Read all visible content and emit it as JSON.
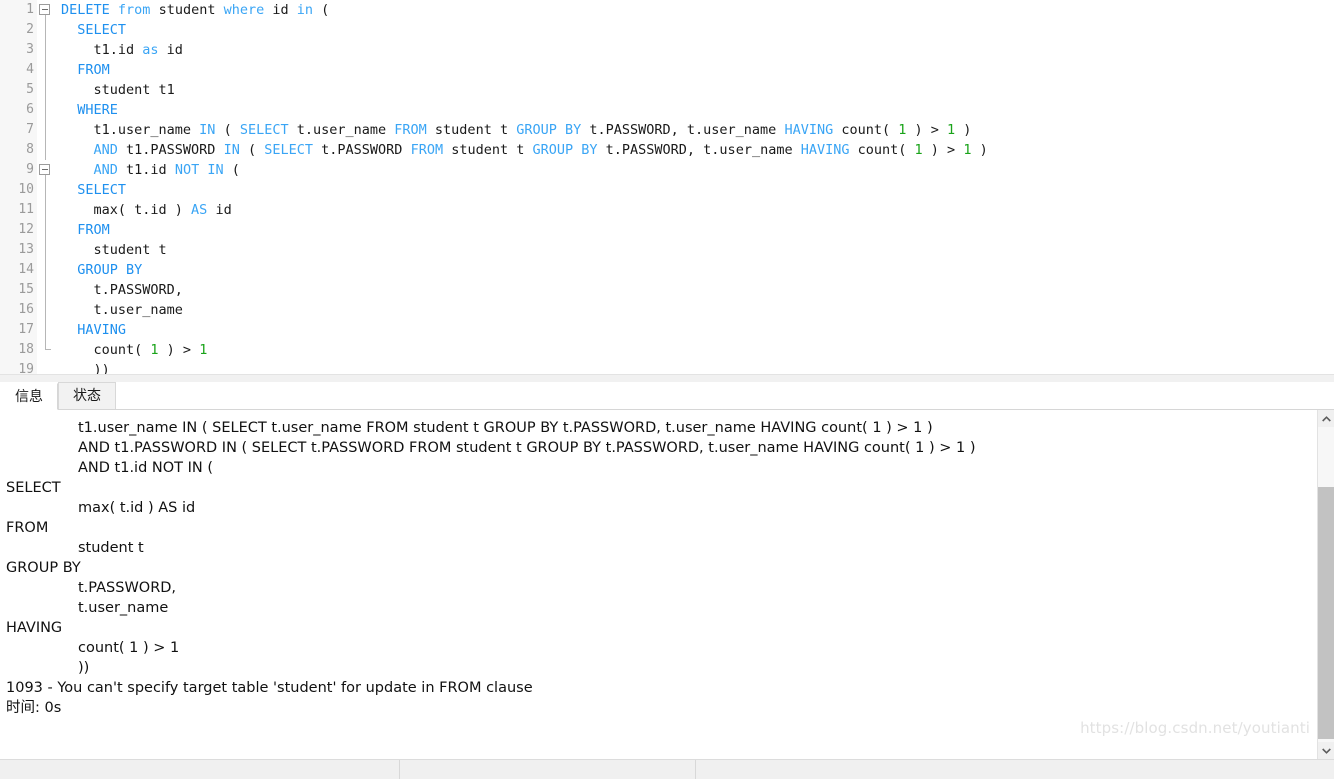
{
  "editor": {
    "language": "sql",
    "lines": [
      {
        "n": "1",
        "fold": "start",
        "tokens": [
          {
            "t": "DELETE",
            "c": "kw"
          },
          {
            "t": " ",
            "c": "pl"
          },
          {
            "t": "from",
            "c": "kw2"
          },
          {
            "t": " student ",
            "c": "pl"
          },
          {
            "t": "where",
            "c": "kw2"
          },
          {
            "t": " id ",
            "c": "pl"
          },
          {
            "t": "in",
            "c": "kw2"
          },
          {
            "t": " (",
            "c": "pl"
          }
        ]
      },
      {
        "n": "2",
        "fold": "guide",
        "tokens": [
          {
            "t": "  ",
            "c": "pl"
          },
          {
            "t": "SELECT",
            "c": "kw"
          }
        ]
      },
      {
        "n": "3",
        "fold": "guide",
        "tokens": [
          {
            "t": "    t1.id ",
            "c": "pl"
          },
          {
            "t": "as",
            "c": "kw2"
          },
          {
            "t": " id",
            "c": "pl"
          }
        ]
      },
      {
        "n": "4",
        "fold": "guide",
        "tokens": [
          {
            "t": "  ",
            "c": "pl"
          },
          {
            "t": "FROM",
            "c": "kw"
          }
        ]
      },
      {
        "n": "5",
        "fold": "guide",
        "tokens": [
          {
            "t": "    student t1",
            "c": "pl"
          }
        ]
      },
      {
        "n": "6",
        "fold": "guide",
        "tokens": [
          {
            "t": "  ",
            "c": "pl"
          },
          {
            "t": "WHERE",
            "c": "kw"
          }
        ]
      },
      {
        "n": "7",
        "fold": "guide",
        "tokens": [
          {
            "t": "    t1.user_name ",
            "c": "pl"
          },
          {
            "t": "IN",
            "c": "kw2"
          },
          {
            "t": " ( ",
            "c": "pl"
          },
          {
            "t": "SELECT",
            "c": "kw2"
          },
          {
            "t": " t.user_name ",
            "c": "pl"
          },
          {
            "t": "FROM",
            "c": "kw2"
          },
          {
            "t": " student t ",
            "c": "pl"
          },
          {
            "t": "GROUP BY",
            "c": "kw2"
          },
          {
            "t": " t.PASSWORD",
            "c": "pl"
          },
          {
            "t": ", t.user_name ",
            "c": "pl"
          },
          {
            "t": "HAVING",
            "c": "kw2"
          },
          {
            "t": " count( ",
            "c": "pl"
          },
          {
            "t": "1",
            "c": "num"
          },
          {
            "t": " ) > ",
            "c": "pl"
          },
          {
            "t": "1",
            "c": "num"
          },
          {
            "t": " )",
            "c": "pl"
          }
        ]
      },
      {
        "n": "8",
        "fold": "guide",
        "tokens": [
          {
            "t": "    ",
            "c": "pl"
          },
          {
            "t": "AND",
            "c": "kw2"
          },
          {
            "t": " t1.PASSWORD ",
            "c": "pl"
          },
          {
            "t": "IN",
            "c": "kw2"
          },
          {
            "t": " ( ",
            "c": "pl"
          },
          {
            "t": "SELECT",
            "c": "kw2"
          },
          {
            "t": " t.PASSWORD ",
            "c": "pl"
          },
          {
            "t": "FROM",
            "c": "kw2"
          },
          {
            "t": " student t ",
            "c": "pl"
          },
          {
            "t": "GROUP BY",
            "c": "kw2"
          },
          {
            "t": " t.PASSWORD",
            "c": "pl"
          },
          {
            "t": ", t.user_name ",
            "c": "pl"
          },
          {
            "t": "HAVING",
            "c": "kw2"
          },
          {
            "t": " count( ",
            "c": "pl"
          },
          {
            "t": "1",
            "c": "num"
          },
          {
            "t": " ) > ",
            "c": "pl"
          },
          {
            "t": "1",
            "c": "num"
          },
          {
            "t": " )",
            "c": "pl"
          }
        ]
      },
      {
        "n": "9",
        "fold": "start2",
        "tokens": [
          {
            "t": "    ",
            "c": "pl"
          },
          {
            "t": "AND",
            "c": "kw2"
          },
          {
            "t": " t1.id ",
            "c": "pl"
          },
          {
            "t": "NOT IN",
            "c": "kw2"
          },
          {
            "t": " (",
            "c": "pl"
          }
        ]
      },
      {
        "n": "10",
        "fold": "guide",
        "tokens": [
          {
            "t": "  ",
            "c": "pl"
          },
          {
            "t": "SELECT",
            "c": "kw"
          }
        ]
      },
      {
        "n": "11",
        "fold": "guide",
        "tokens": [
          {
            "t": "    max( t.id ) ",
            "c": "pl"
          },
          {
            "t": "AS",
            "c": "kw2"
          },
          {
            "t": " id",
            "c": "pl"
          }
        ]
      },
      {
        "n": "12",
        "fold": "guide",
        "tokens": [
          {
            "t": "  ",
            "c": "pl"
          },
          {
            "t": "FROM",
            "c": "kw"
          }
        ]
      },
      {
        "n": "13",
        "fold": "guide",
        "tokens": [
          {
            "t": "    student t",
            "c": "pl"
          }
        ]
      },
      {
        "n": "14",
        "fold": "guide",
        "tokens": [
          {
            "t": "  ",
            "c": "pl"
          },
          {
            "t": "GROUP BY",
            "c": "kw"
          }
        ]
      },
      {
        "n": "15",
        "fold": "guide",
        "tokens": [
          {
            "t": "    t.PASSWORD,",
            "c": "pl"
          }
        ]
      },
      {
        "n": "16",
        "fold": "guide",
        "tokens": [
          {
            "t": "    t.user_name",
            "c": "pl"
          }
        ]
      },
      {
        "n": "17",
        "fold": "guide",
        "tokens": [
          {
            "t": "  ",
            "c": "pl"
          },
          {
            "t": "HAVING",
            "c": "kw"
          }
        ]
      },
      {
        "n": "18",
        "fold": "end",
        "tokens": [
          {
            "t": "    count( ",
            "c": "pl"
          },
          {
            "t": "1",
            "c": "num"
          },
          {
            "t": " ) > ",
            "c": "pl"
          },
          {
            "t": "1",
            "c": "num"
          }
        ]
      },
      {
        "n": "19",
        "fold": "none",
        "tokens": [
          {
            "t": "    ))",
            "c": "pl"
          }
        ]
      }
    ]
  },
  "tabs": [
    {
      "label": "信息",
      "active": true
    },
    {
      "label": "状态",
      "active": false
    }
  ],
  "result": {
    "lines": [
      {
        "text": "t1.user_name IN ( SELECT t.user_name FROM student t GROUP BY t.PASSWORD, t.user_name HAVING count( 1 ) > 1 )",
        "indent": true
      },
      {
        "text": "AND t1.PASSWORD IN ( SELECT t.PASSWORD FROM student t GROUP BY t.PASSWORD, t.user_name HAVING count( 1 ) > 1 )",
        "indent": true
      },
      {
        "text": "AND t1.id NOT IN (",
        "indent": true
      },
      {
        "text": "SELECT",
        "indent": false
      },
      {
        "text": "max( t.id ) AS id",
        "indent": true
      },
      {
        "text": "FROM",
        "indent": false
      },
      {
        "text": "student t",
        "indent": true
      },
      {
        "text": "GROUP BY",
        "indent": false
      },
      {
        "text": "t.PASSWORD,",
        "indent": true
      },
      {
        "text": "t.user_name",
        "indent": true
      },
      {
        "text": "HAVING",
        "indent": false
      },
      {
        "text": "count( 1 ) > 1",
        "indent": true
      },
      {
        "text": "))",
        "indent": true
      },
      {
        "text": "1093 - You can't specify target table 'student' for update in FROM clause",
        "indent": false
      },
      {
        "text": "时间: 0s",
        "indent": false
      }
    ],
    "error_code": "1093",
    "error_message": "You can't specify target table 'student' for update in FROM clause",
    "elapsed": "时间: 0s"
  },
  "scrollbar": {
    "up_arrow": "⌃",
    "down_arrow": "⌄"
  },
  "watermark": {
    "text": "https://blog.csdn.net/youtianti"
  },
  "statusbar": {
    "cell1": "",
    "cell2": "",
    "cell3": ""
  },
  "colors": {
    "keyword": "#1e90ef",
    "keyword_secondary": "#3aa5f5",
    "number": "#19a319",
    "plain": "#1a1a1a",
    "gutter_bg": "#f7f7f7",
    "gutter_text": "#9a9a9a",
    "watermark": "#e2e2e2",
    "scroll_thumb": "#c2c2c2"
  }
}
